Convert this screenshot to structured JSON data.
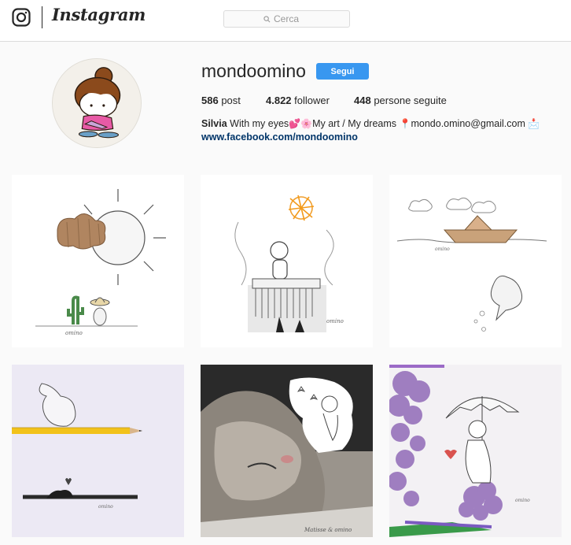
{
  "nav": {
    "brand": "Instagram",
    "search_placeholder": "Cerca"
  },
  "profile": {
    "username": "mondoomino",
    "follow_label": "Segui",
    "stats": {
      "posts_count": "586",
      "posts_label": "post",
      "followers_count": "4.822",
      "followers_label": "follower",
      "following_count": "448",
      "following_label": "persone seguite"
    },
    "bio": {
      "name": "Silvia",
      "text_1": "With my eyes",
      "text_2": "My art / My dreams",
      "email": "mondo.omino@gmail.com",
      "link": "www.facebook.com/mondoomino"
    }
  },
  "posts": [
    {
      "caption": "omino",
      "icon": "sun-cloud-cactus"
    },
    {
      "caption": "omino",
      "icon": "sun-figure-comb"
    },
    {
      "caption": "omino",
      "icon": "paper-boat-dolphin"
    },
    {
      "caption": "omino",
      "icon": "cat-pencil"
    },
    {
      "caption": "Matisse & omino",
      "icon": "cat-photo"
    },
    {
      "caption": "omino",
      "icon": "girl-umbrella-lilacs"
    }
  ],
  "colors": {
    "accent": "#3897f0",
    "link": "#003569",
    "border": "#dbdbdb",
    "background": "#fafafa"
  }
}
